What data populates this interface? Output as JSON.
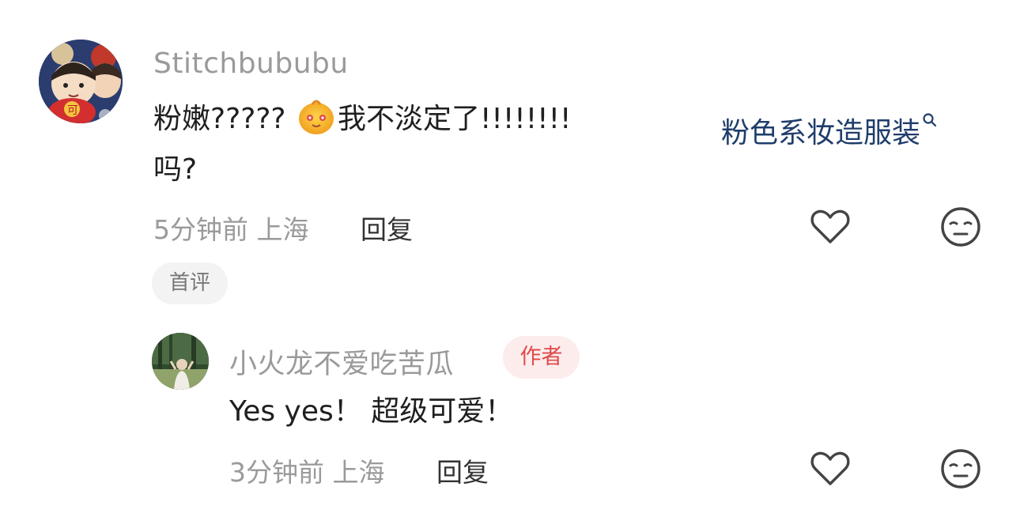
{
  "comments": [
    {
      "username": "Stitchbububu",
      "text_part1": "粉嫩?????",
      "emoji": "smiling-face-emoji",
      "text_part2": "我不淡定了!!!!!!!!",
      "topic_link": "粉色系妆造服装",
      "text_line2": "吗?",
      "time": "5分钟前",
      "location": "上海",
      "reply_label": "回复",
      "badge": "首评"
    },
    {
      "username": "小火龙不爱吃苦瓜",
      "author_badge": "作者",
      "text": "Yes yes！ 超级可爱！",
      "time": "3分钟前",
      "location": "上海",
      "reply_label": "回复"
    }
  ],
  "icons": {
    "like": "heart-outline-icon",
    "dislike": "meh-face-icon",
    "search": "search-icon"
  },
  "colors": {
    "link": "#1f3d6b",
    "author_badge_text": "#e04a4a",
    "author_badge_bg": "#fdecec",
    "muted": "#9a9a9a"
  }
}
